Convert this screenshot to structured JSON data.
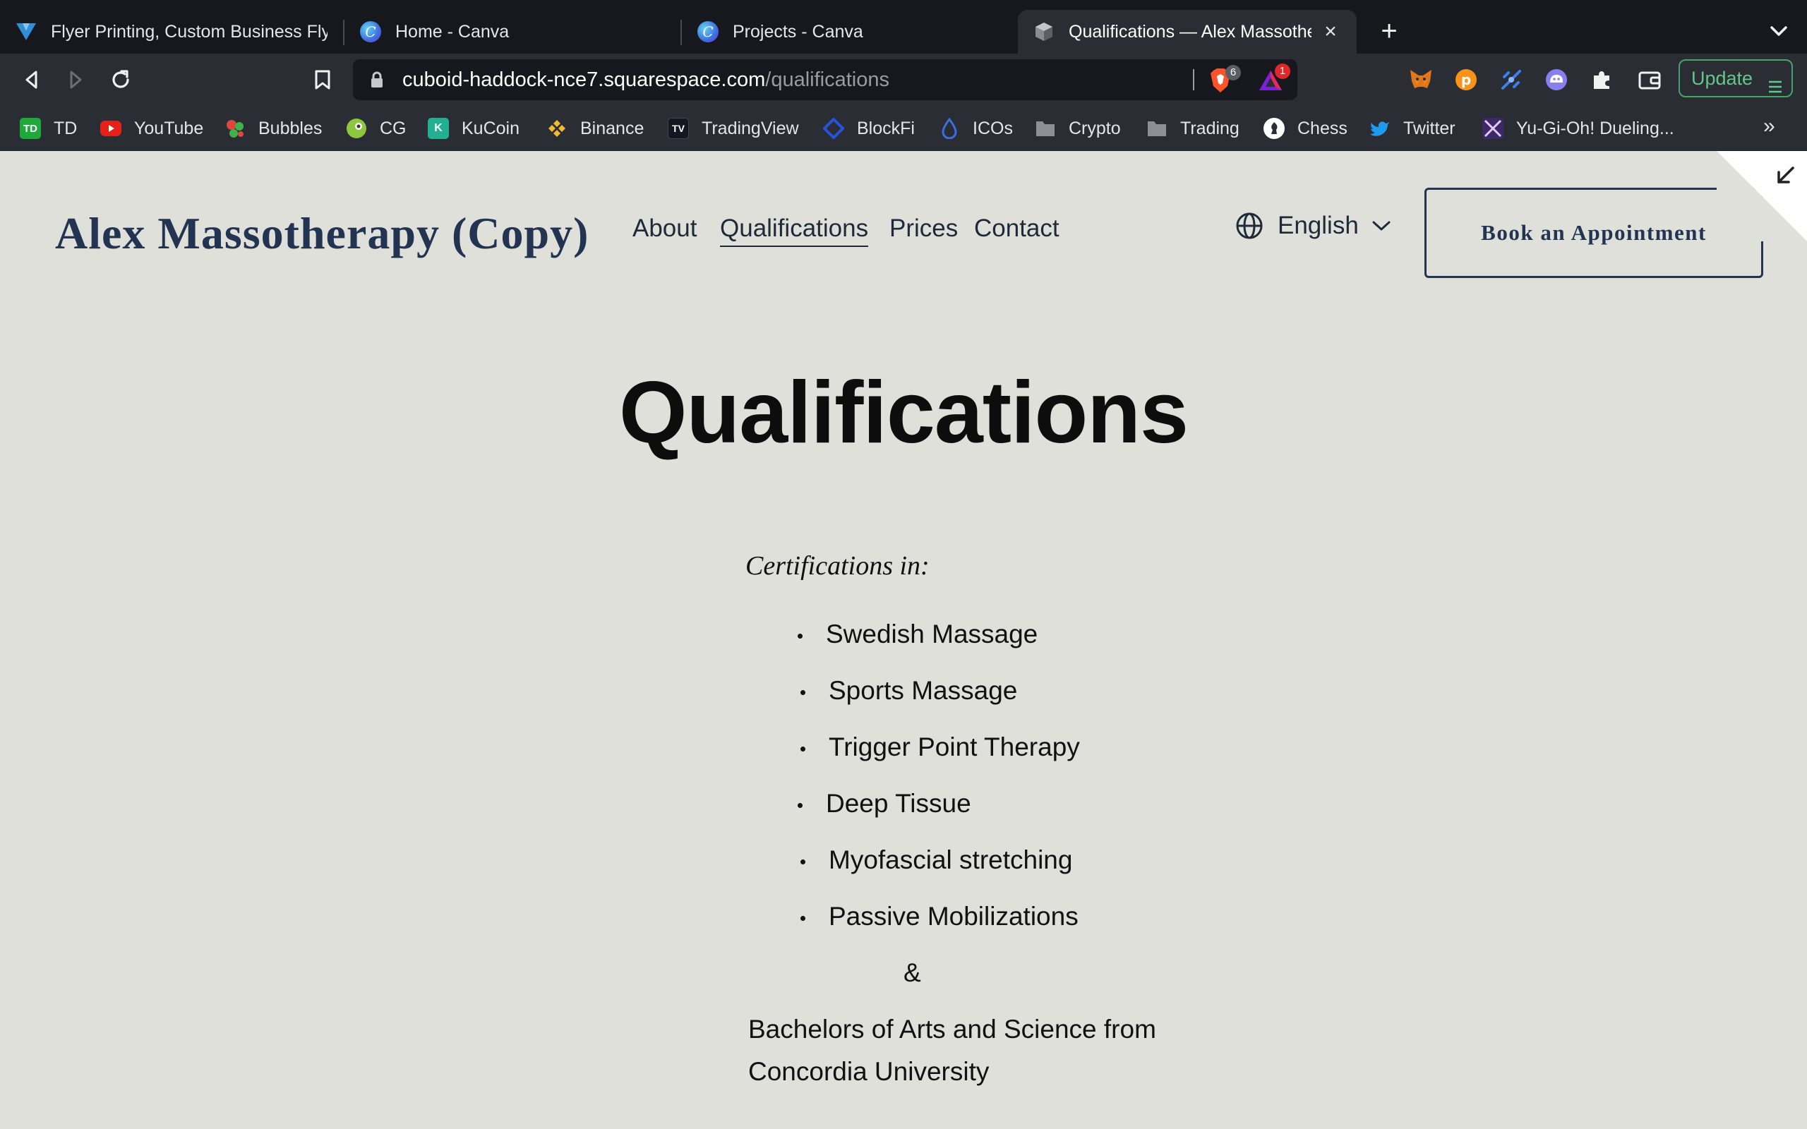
{
  "browser": {
    "tabs": [
      {
        "title": "Flyer Printing, Custom Business Flye",
        "icon": "vistaprint-icon"
      },
      {
        "title": "Home - Canva",
        "icon": "canva-icon"
      },
      {
        "title": "Projects - Canva",
        "icon": "canva-icon"
      },
      {
        "title": "Qualifications — Alex Massothe",
        "icon": "squarespace-icon",
        "active": true
      }
    ],
    "url_host": "cuboid-haddock-nce7.squarespace.com",
    "url_path": "/qualifications",
    "brave_shields_count": "6",
    "brave_rewards_count": "1",
    "update_label": "Update",
    "bookmarks": [
      {
        "label": "TD",
        "icon": "td-icon"
      },
      {
        "label": "YouTube",
        "icon": "youtube-icon"
      },
      {
        "label": "Bubbles",
        "icon": "bubbles-icon"
      },
      {
        "label": "CG",
        "icon": "coingecko-icon"
      },
      {
        "label": "KuCoin",
        "icon": "kucoin-icon"
      },
      {
        "label": "Binance",
        "icon": "binance-icon"
      },
      {
        "label": "TradingView",
        "icon": "tradingview-icon"
      },
      {
        "label": "BlockFi",
        "icon": "blockfi-icon"
      },
      {
        "label": "ICOs",
        "icon": "icos-icon"
      },
      {
        "label": "Crypto",
        "icon": "folder-icon"
      },
      {
        "label": "Trading",
        "icon": "folder-icon"
      },
      {
        "label": "Chess",
        "icon": "chess-icon"
      },
      {
        "label": "Twitter",
        "icon": "twitter-icon"
      },
      {
        "label": "Yu-Gi-Oh! Dueling...",
        "icon": "yugioh-icon"
      }
    ],
    "bookmarks_overflow": "»"
  },
  "site": {
    "title": "Alex Massotherapy (Copy)",
    "nav": [
      "About",
      "Qualifications",
      "Prices",
      "Contact"
    ],
    "active_nav": "Qualifications",
    "language": "English",
    "cta": "Book an Appointment"
  },
  "content": {
    "heading": "Qualifications",
    "intro": "Certifications in:",
    "certifications": [
      "Swedish Massage",
      "Sports Massage",
      "Trigger Point Therapy",
      "Deep Tissue",
      "Myofascial stretching",
      "Passive Mobilizations"
    ],
    "ampersand": "&",
    "degree_line1": "Bachelors of Arts and Science from",
    "degree_line2": "Concordia University"
  },
  "colors": {
    "page_bg": "#dfe0d9",
    "brand_navy": "#233452",
    "browser_dark": "#17181e",
    "toolbar": "#2b2d35",
    "update_green": "#46a46a"
  }
}
